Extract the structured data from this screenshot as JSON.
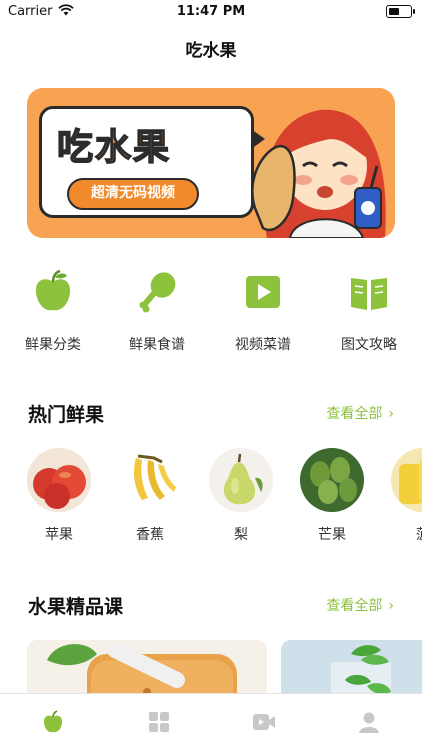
{
  "status_bar": {
    "carrier": "Carrier",
    "time": "11:47 PM"
  },
  "nav": {
    "title": "吃水果"
  },
  "banner": {
    "headline": "吃水果",
    "pill": "超清无码视频"
  },
  "categories": [
    {
      "label": "鲜果分类",
      "icon": "apple-icon"
    },
    {
      "label": "鲜果食谱",
      "icon": "drumstick-icon"
    },
    {
      "label": "视频菜谱",
      "icon": "play-video-icon"
    },
    {
      "label": "图文攻略",
      "icon": "open-book-icon"
    }
  ],
  "hot_fruits": {
    "title": "热门鲜果",
    "see_all": "查看全部",
    "items": [
      {
        "name": "苹果"
      },
      {
        "name": "香蕉"
      },
      {
        "name": "梨"
      },
      {
        "name": "芒果"
      },
      {
        "name": "菠"
      }
    ]
  },
  "courses": {
    "title": "水果精品课",
    "see_all": "查看全部"
  },
  "tabs": [
    {
      "icon": "apple-tab-icon",
      "active": true
    },
    {
      "icon": "grid-tab-icon",
      "active": false
    },
    {
      "icon": "video-tab-icon",
      "active": false
    },
    {
      "icon": "profile-tab-icon",
      "active": false
    }
  ],
  "colors": {
    "accent": "#8dc23c",
    "banner": "#f7a352",
    "inactive_tab": "#c8c8c8"
  }
}
